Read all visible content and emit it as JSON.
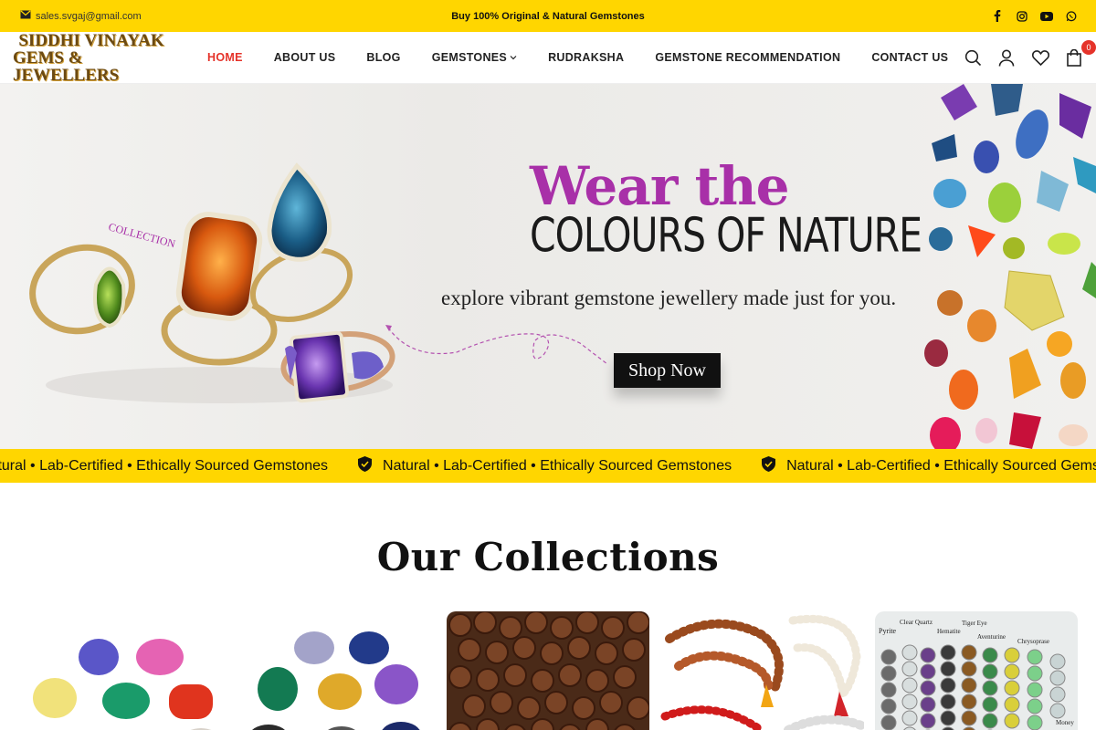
{
  "topbar": {
    "email": "sales.svgaj@gmail.com",
    "promo": "Buy 100% Original & Natural Gemstones",
    "social_icons": [
      "facebook-icon",
      "instagram-icon",
      "youtube-icon",
      "whatsapp-icon"
    ]
  },
  "logo": {
    "line1": "SIDDHI VINAYAK",
    "line2": "GEMS & JEWELLERS"
  },
  "nav": {
    "items": [
      "HOME",
      "ABOUT US",
      "BLOG",
      "GEMSTONES",
      "RUDRAKSHA",
      "GEMSTONE RECOMMENDATION",
      "CONTACT US"
    ],
    "active": "HOME"
  },
  "header_icons": {
    "cart_count": "0"
  },
  "hero": {
    "title_line1": "Wear the",
    "title_line2": "COLOURS OF NATURE",
    "subtitle": "explore vibrant gemstone jewellery made just for you.",
    "cta": "Shop Now",
    "ring_label": "COLLECTION"
  },
  "marquee": {
    "text": "Natural • Lab-Certified • Ethically Sourced Gemstones"
  },
  "collections": {
    "title": "Our Collections",
    "card5_labels": [
      "Pyrite",
      "Clear Quartz",
      "Hematite",
      "Tiger Eye",
      "Aventurine",
      "Chrysoprase",
      "Money"
    ]
  },
  "colors": {
    "accent_yellow": "#ffd600",
    "active_red": "#e5332a",
    "hero_purple": "#a830a8"
  }
}
